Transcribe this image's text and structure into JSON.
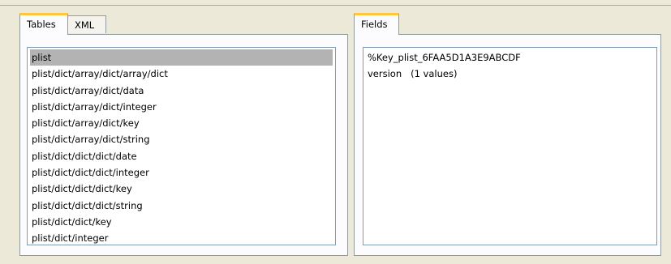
{
  "left_panel": {
    "tabs": [
      {
        "label": "Tables",
        "active": true
      },
      {
        "label": "XML",
        "active": false
      }
    ],
    "tables": [
      "plist",
      "plist/dict/array/dict/array/dict",
      "plist/dict/array/dict/data",
      "plist/dict/array/dict/integer",
      "plist/dict/array/dict/key",
      "plist/dict/array/dict/string",
      "plist/dict/dict/dict/date",
      "plist/dict/dict/dict/integer",
      "plist/dict/dict/dict/key",
      "plist/dict/dict/dict/string",
      "plist/dict/dict/key",
      "plist/dict/integer"
    ],
    "selected_index": 0
  },
  "right_panel": {
    "tabs": [
      {
        "label": "Fields",
        "active": true
      }
    ],
    "fields": [
      "%Key_plist_6FAA5D1A3E9ABCDF",
      "version   (1 values)"
    ]
  },
  "colors": {
    "background": "#ece9d8",
    "tab_highlight": "#ffc83c",
    "selection": "#b3b3b3",
    "border": "#919b9c"
  }
}
